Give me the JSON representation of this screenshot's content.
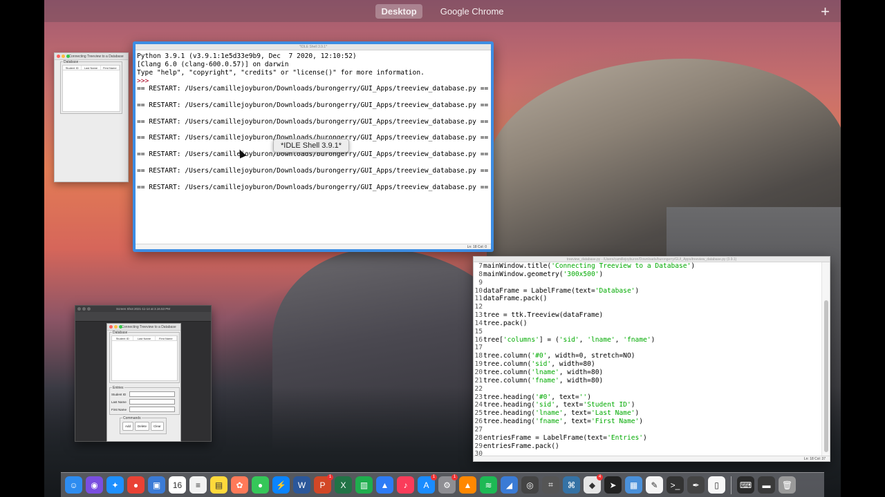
{
  "spaces": {
    "items": [
      {
        "label": "Desktop",
        "active": true
      },
      {
        "label": "Google Chrome",
        "active": false
      }
    ],
    "add_label": "+"
  },
  "tk_window": {
    "title": "Connecting Treeview to a Database",
    "frame_label": "Database",
    "columns": [
      "Student ID",
      "Last Name",
      "First Name"
    ]
  },
  "idle_shell": {
    "title": "*IDLE Shell 3.9.1*",
    "banner": [
      "Python 3.9.1 (v3.9.1:1e5d33e9b9, Dec  7 2020, 12:10:52)",
      "[Clang 6.0 (clang-600.0.57)] on darwin",
      "Type \"help\", \"copyright\", \"credits\" or \"license()\" for more information."
    ],
    "prompt": ">>>",
    "restart_line": "== RESTART: /Users/camillejoyburon/Downloads/burongerry/GUI_Apps/treeview_database.py ==",
    "status": "Ln: 18  Col: 0",
    "tooltip": "*IDLE Shell 3.9.1*"
  },
  "editor": {
    "title": "treeview_database.py - /Users/camillejoyburon/Downloads/burongerry/GUI_Apps/treeview_database.py (3.9.1)",
    "status": "Ln: 18  Col: 37",
    "lines": [
      {
        "n": "7",
        "code": [
          {
            "t": "mainWindow.title("
          },
          {
            "t": "'Connecting Treeview to a Database'",
            "s": true
          },
          {
            "t": ")"
          }
        ]
      },
      {
        "n": "8",
        "code": [
          {
            "t": "mainWindow.geometry("
          },
          {
            "t": "'300x500'",
            "s": true
          },
          {
            "t": ")"
          }
        ]
      },
      {
        "n": "9",
        "code": []
      },
      {
        "n": "10",
        "code": [
          {
            "t": "dataFrame = LabelFrame(text="
          },
          {
            "t": "'Database'",
            "s": true
          },
          {
            "t": ")"
          }
        ]
      },
      {
        "n": "11",
        "code": [
          {
            "t": "dataFrame.pack()"
          }
        ]
      },
      {
        "n": "12",
        "code": []
      },
      {
        "n": "13",
        "code": [
          {
            "t": "tree = ttk.Treeview(dataFrame)"
          }
        ]
      },
      {
        "n": "14",
        "code": [
          {
            "t": "tree.pack()"
          }
        ]
      },
      {
        "n": "15",
        "code": []
      },
      {
        "n": "16",
        "code": [
          {
            "t": "tree["
          },
          {
            "t": "'columns'",
            "s": true
          },
          {
            "t": "] = ("
          },
          {
            "t": "'sid'",
            "s": true
          },
          {
            "t": ", "
          },
          {
            "t": "'lname'",
            "s": true
          },
          {
            "t": ", "
          },
          {
            "t": "'fname'",
            "s": true
          },
          {
            "t": ")"
          }
        ]
      },
      {
        "n": "17",
        "code": []
      },
      {
        "n": "18",
        "code": [
          {
            "t": "tree.column("
          },
          {
            "t": "'#0'",
            "s": true
          },
          {
            "t": ", width=0, stretch=NO)"
          }
        ]
      },
      {
        "n": "19",
        "code": [
          {
            "t": "tree.column("
          },
          {
            "t": "'sid'",
            "s": true
          },
          {
            "t": ", width=80)"
          }
        ]
      },
      {
        "n": "20",
        "code": [
          {
            "t": "tree.column("
          },
          {
            "t": "'lname'",
            "s": true
          },
          {
            "t": ", width=80)"
          }
        ]
      },
      {
        "n": "21",
        "code": [
          {
            "t": "tree.column("
          },
          {
            "t": "'fname'",
            "s": true
          },
          {
            "t": ", width=80)"
          }
        ]
      },
      {
        "n": "22",
        "code": []
      },
      {
        "n": "23",
        "code": [
          {
            "t": "tree.heading("
          },
          {
            "t": "'#0'",
            "s": true
          },
          {
            "t": ", text="
          },
          {
            "t": "''",
            "s": true
          },
          {
            "t": ")"
          }
        ]
      },
      {
        "n": "24",
        "code": [
          {
            "t": "tree.heading("
          },
          {
            "t": "'sid'",
            "s": true
          },
          {
            "t": ", text="
          },
          {
            "t": "'Student ID'",
            "s": true
          },
          {
            "t": ")"
          }
        ]
      },
      {
        "n": "25",
        "code": [
          {
            "t": "tree.heading("
          },
          {
            "t": "'lname'",
            "s": true
          },
          {
            "t": ", text="
          },
          {
            "t": "'Last Name'",
            "s": true
          },
          {
            "t": ")"
          }
        ]
      },
      {
        "n": "26",
        "code": [
          {
            "t": "tree.heading("
          },
          {
            "t": "'fname'",
            "s": true
          },
          {
            "t": ", text="
          },
          {
            "t": "'First Name'",
            "s": true
          },
          {
            "t": ")"
          }
        ]
      },
      {
        "n": "27",
        "code": []
      },
      {
        "n": "28",
        "code": [
          {
            "t": "entriesFrame = LabelFrame(text="
          },
          {
            "t": "'Entries'",
            "s": true
          },
          {
            "t": ")"
          }
        ]
      },
      {
        "n": "29",
        "code": [
          {
            "t": "entriesFrame.pack()"
          }
        ]
      },
      {
        "n": "30",
        "code": []
      }
    ]
  },
  "dark_window": {
    "title": "Screen Shot 2021-11-14 at 3.16.53 PM",
    "tk_title": "Connecting Treeview to a Database",
    "frame_label": "Database",
    "columns": [
      "Student ID",
      "Last Name",
      "First Name"
    ],
    "entries_label": "Entries",
    "entry_fields": [
      "Student ID",
      "Last Name",
      "First Name"
    ],
    "commands_label": "Commands",
    "buttons": [
      "Add",
      "Delete",
      "Clear"
    ]
  },
  "dock": {
    "calendar_day": "16",
    "items": [
      {
        "name": "finder-icon",
        "color": "#2d8cf0",
        "glyph": "☺"
      },
      {
        "name": "siri-icon",
        "color": "#7a4ee0",
        "glyph": "◉"
      },
      {
        "name": "safari-icon",
        "color": "#1e90ff",
        "glyph": "✦"
      },
      {
        "name": "chrome-icon",
        "color": "#e94235",
        "glyph": "●"
      },
      {
        "name": "preview-icon",
        "color": "#3b7bd6",
        "glyph": "▣"
      },
      {
        "name": "calendar-icon",
        "color": "#ffffff",
        "glyph": "16"
      },
      {
        "name": "notes-list-icon",
        "color": "#f2f2f2",
        "glyph": "≡"
      },
      {
        "name": "notes-icon",
        "color": "#ffd93b",
        "glyph": "▤"
      },
      {
        "name": "photos-icon",
        "color": "#ff7a59",
        "glyph": "✿"
      },
      {
        "name": "messages-icon",
        "color": "#35c759",
        "glyph": "●"
      },
      {
        "name": "messenger-icon",
        "color": "#0a84ff",
        "glyph": "⚡"
      },
      {
        "name": "word-icon",
        "color": "#2b579a",
        "glyph": "W"
      },
      {
        "name": "powerpoint-icon",
        "color": "#d24726",
        "glyph": "P",
        "badge": "1"
      },
      {
        "name": "excel-icon",
        "color": "#217346",
        "glyph": "X"
      },
      {
        "name": "numbers-icon",
        "color": "#1fae4e",
        "glyph": "▥"
      },
      {
        "name": "keynote-icon",
        "color": "#2e7cf6",
        "glyph": "▲"
      },
      {
        "name": "music-icon",
        "color": "#fa3c5a",
        "glyph": "♪"
      },
      {
        "name": "app-store-icon",
        "color": "#1a8cff",
        "glyph": "A",
        "badge": "1"
      },
      {
        "name": "system-preferences-icon",
        "color": "#8e8e93",
        "glyph": "⚙",
        "badge": "1"
      },
      {
        "name": "vlc-icon",
        "color": "#ff8800",
        "glyph": "▲"
      },
      {
        "name": "spotify-icon",
        "color": "#1db954",
        "glyph": "≋"
      },
      {
        "name": "vysor-icon",
        "color": "#3a7bd5",
        "glyph": "◢"
      },
      {
        "name": "camera-icon",
        "color": "#444444",
        "glyph": "◎"
      },
      {
        "name": "screenshot-icon",
        "color": "#555555",
        "glyph": "⌗"
      },
      {
        "name": "python-idle-icon",
        "color": "#3572a5",
        "glyph": "⌘"
      },
      {
        "name": "launcher-icon",
        "color": "#e6e6e6",
        "glyph": "◆",
        "badge": "4"
      },
      {
        "name": "arrow-app-icon",
        "color": "#222222",
        "glyph": "➤"
      },
      {
        "name": "preview-image-icon",
        "color": "#4a90d9",
        "glyph": "▦"
      },
      {
        "name": "textedit-icon",
        "color": "#f5f5f5",
        "glyph": "✎"
      },
      {
        "name": "terminal-icon",
        "color": "#333333",
        "glyph": ">_"
      },
      {
        "name": "pen-icon",
        "color": "#444444",
        "glyph": "✒"
      },
      {
        "name": "document-icon",
        "color": "#f7f7f7",
        "glyph": "▯"
      },
      {
        "name": "keyboard-icon",
        "color": "#2b2b2b",
        "glyph": "⌨"
      },
      {
        "name": "folder-icon",
        "color": "#3a3a3a",
        "glyph": "▬"
      },
      {
        "name": "trash-icon",
        "color": "#9a9a9a",
        "glyph": "🗑"
      }
    ]
  }
}
